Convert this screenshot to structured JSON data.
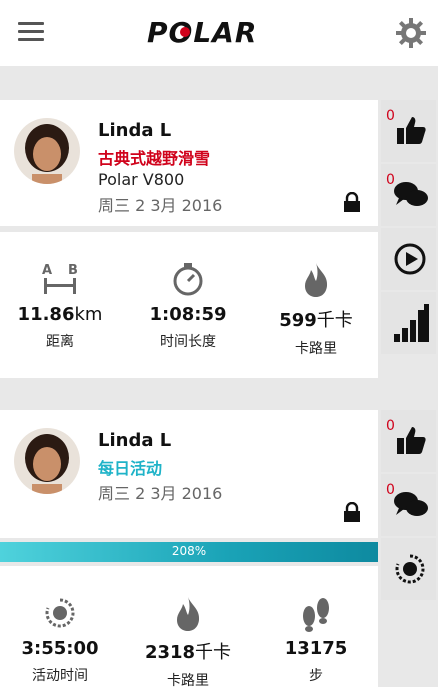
{
  "header": {
    "logo_text": "POLAR"
  },
  "feed": [
    {
      "user": "Linda L",
      "sport": "古典式越野滑雪",
      "sport_color": "#d0021b",
      "device": "Polar V800",
      "date": "周三 2 3月 2016",
      "likes": "0",
      "comments": "0",
      "stats": [
        {
          "value": "11.86",
          "unit": "km",
          "label": "距离",
          "icon": "distance-icon"
        },
        {
          "value": "1:08:59",
          "unit": "",
          "label": "时间长度",
          "icon": "stopwatch-icon"
        },
        {
          "value": "599",
          "unit": "千卡",
          "label": "卡路里",
          "icon": "flame-icon"
        }
      ]
    },
    {
      "user": "Linda L",
      "sport": "每日活动",
      "sport_color": "#1fb3c8",
      "date": "周三 2 3月 2016",
      "likes": "0",
      "comments": "0",
      "progress": "208%",
      "progress_fraction": 2.08,
      "stats": [
        {
          "value": "3:55:00",
          "unit": "",
          "label": "活动时间",
          "icon": "activity-ring-icon"
        },
        {
          "value": "2318",
          "unit": "千卡",
          "label": "卡路里",
          "icon": "flame-icon"
        },
        {
          "value": "13175",
          "unit": "",
          "label": "步",
          "icon": "footsteps-icon"
        }
      ]
    }
  ],
  "colors": {
    "accent": "#d0021b",
    "activity": "#1fb3c8",
    "rail": "#e4e4e4"
  }
}
